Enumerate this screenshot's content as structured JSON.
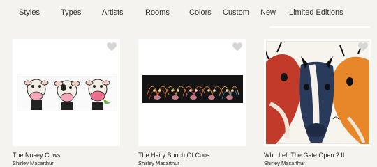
{
  "nav": {
    "items": [
      {
        "label": "Styles"
      },
      {
        "label": "Types"
      },
      {
        "label": "Artists"
      },
      {
        "label": "Rooms"
      },
      {
        "label": "Colors"
      },
      {
        "label": "Custom"
      },
      {
        "label": "New"
      },
      {
        "label": "Limited Editions"
      }
    ]
  },
  "products": [
    {
      "title": "The Nosey Cows",
      "artist": "Shirley Macarthur",
      "icon": "heart-icon"
    },
    {
      "title": "The Hairy Bunch Of Coos",
      "artist": "Shirley Macarthur",
      "icon": "heart-icon"
    },
    {
      "title": "Who Left The Gate Open ? II",
      "artist": "Shirley Macarthur",
      "icon": "heart-icon"
    }
  ],
  "colors": {
    "background": "#f4f3ef",
    "heart": "#d6d6d6",
    "frame": "#ffffff"
  }
}
